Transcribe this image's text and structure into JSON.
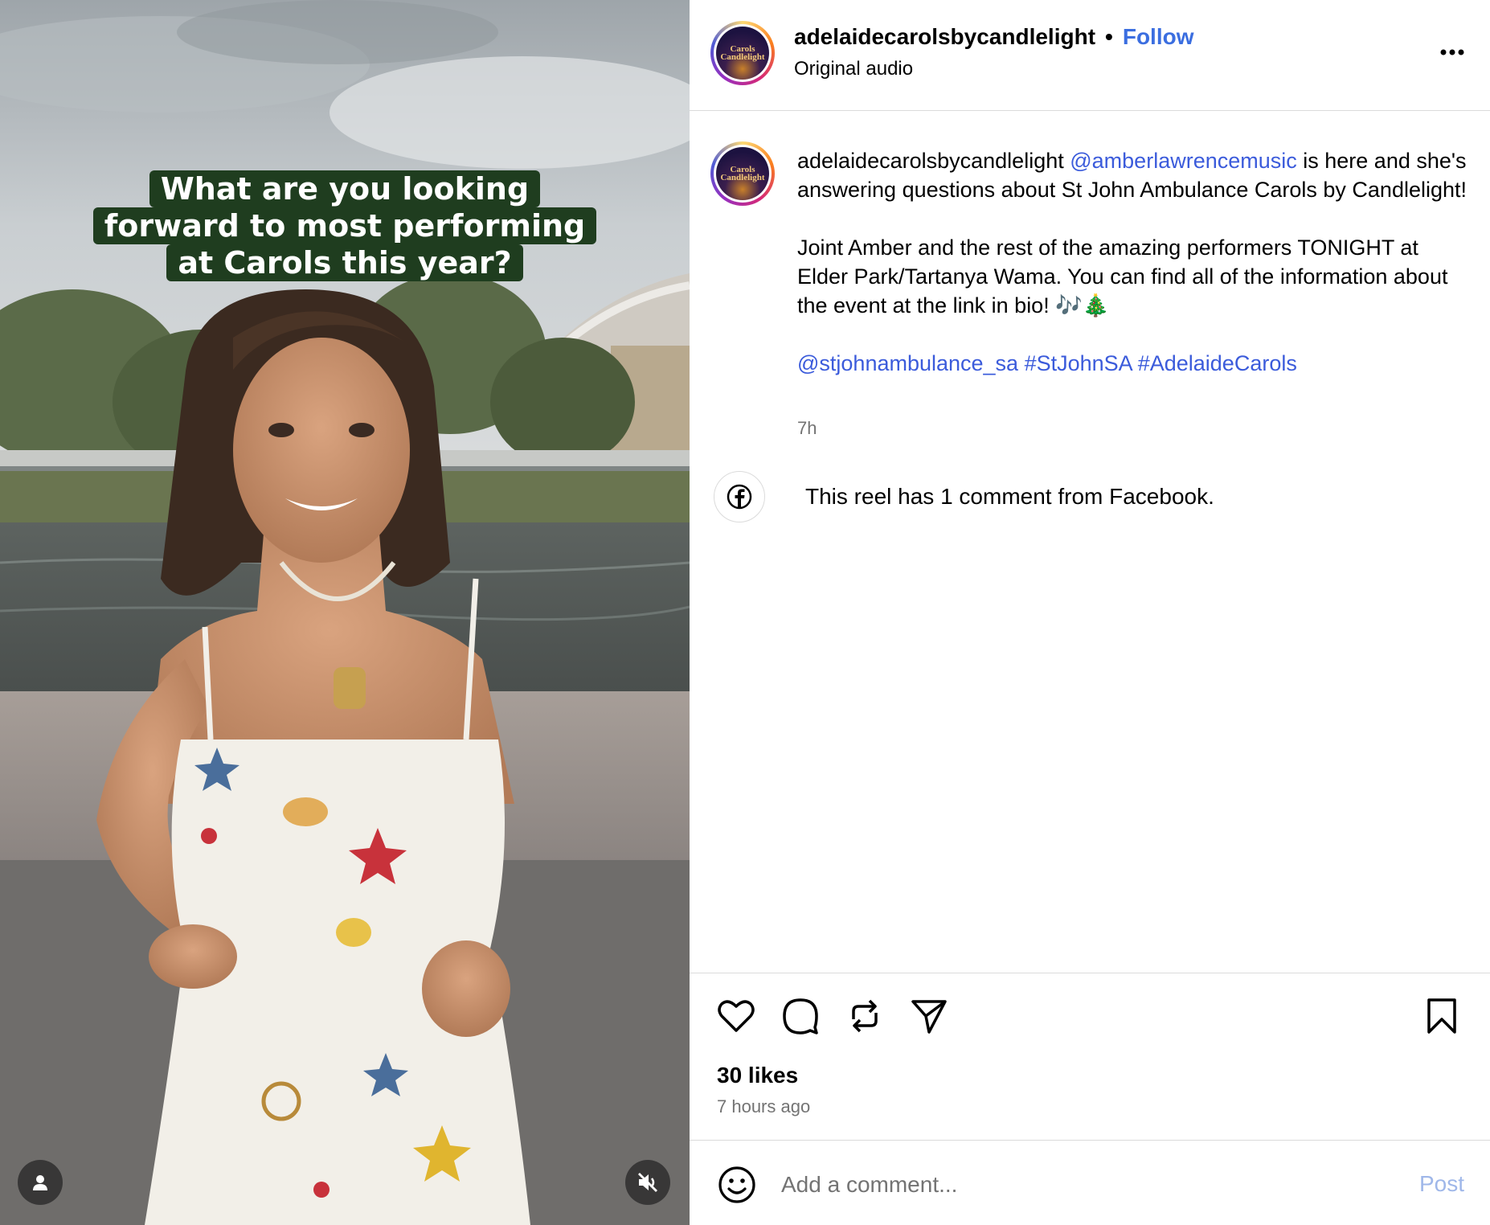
{
  "video": {
    "caption_lines": [
      "What are you looking",
      "forward to most performing",
      "at Carols this year?"
    ],
    "user_icon": "user-icon",
    "mute_icon": "muted-speaker-icon"
  },
  "header": {
    "username": "adelaidecarolsbycandlelight",
    "separator": "•",
    "follow_label": "Follow",
    "audio_label": "Original audio",
    "more_icon": "more-options-icon",
    "avatar_text": [
      "Carols",
      "Candlelight"
    ]
  },
  "post": {
    "author": "adelaidecarolsbycandlelight",
    "mention": "@amberlawrencemusic",
    "para1_rest": "is here and she's answering questions about St John Ambulance Carols by Candlelight!",
    "para2": "Joint Amber and the rest of the amazing performers TONIGHT at Elder Park/Tartanya Wama. You can find all of the information about the event at the link in bio! 🎶🎄",
    "tags": [
      "@stjohnambulance_sa",
      "#StJohnSA",
      "#AdelaideCarols"
    ],
    "time": "7h"
  },
  "facebook": {
    "icon": "facebook-icon",
    "text": "This reel has 1 comment from Facebook."
  },
  "actions": {
    "icons": [
      "heart-icon",
      "comment-icon",
      "repost-icon",
      "share-icon",
      "bookmark-icon"
    ],
    "likes": "30 likes",
    "time_ago": "7 hours ago"
  },
  "comment": {
    "placeholder": "Add a comment...",
    "post_label": "Post",
    "emoji_icon": "emoji-icon"
  },
  "colors": {
    "link": "#3b5bdb",
    "follow": "#3b6ee0",
    "caption_bg": "#1f3d1f",
    "muted_text": "#737373",
    "post_disabled": "#9fb7e9"
  }
}
